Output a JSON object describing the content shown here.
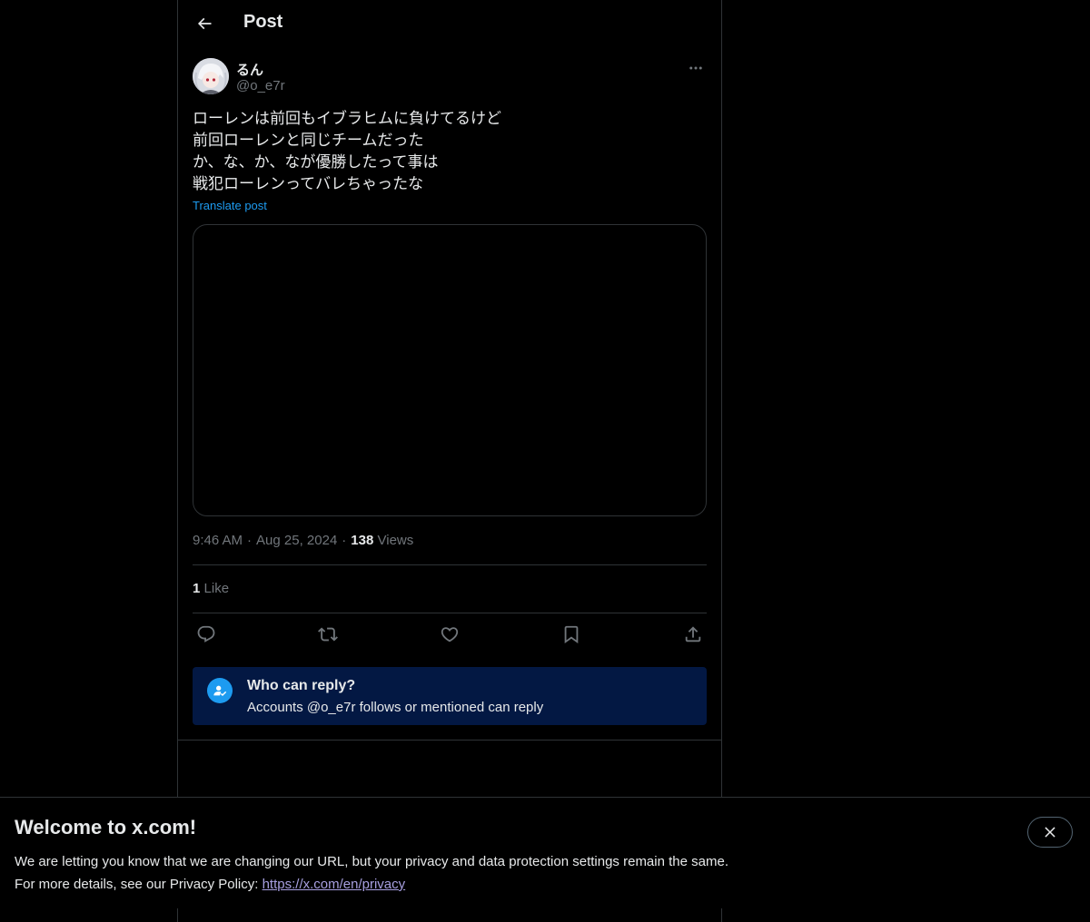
{
  "header": {
    "title": "Post",
    "back_icon": "arrow-left-icon"
  },
  "post": {
    "author": {
      "display_name": "るん",
      "handle": "@o_e7r"
    },
    "text_lines": [
      "ローレンは前回もイブラヒムに負けてるけど",
      "前回ローレンと同じチームだった",
      "か、な、か、なが優勝したって事は",
      "戦犯ローレンってバレちゃったな"
    ],
    "translate_label": "Translate post",
    "time": "9:46 AM",
    "date": "Aug 25, 2024",
    "views_count": "138",
    "views_label": "Views",
    "likes_count": "1",
    "likes_label": "Like"
  },
  "actions": [
    {
      "name": "reply",
      "icon": "comment-icon"
    },
    {
      "name": "repost",
      "icon": "repost-icon"
    },
    {
      "name": "like",
      "icon": "heart-icon"
    },
    {
      "name": "bookmark",
      "icon": "bookmark-icon"
    },
    {
      "name": "share",
      "icon": "share-icon"
    }
  ],
  "reply_restriction": {
    "title": "Who can reply?",
    "subtitle": "Accounts @o_e7r follows or mentioned can reply"
  },
  "banner": {
    "title": "Welcome to x.com!",
    "line1": "We are letting you know that we are changing our URL, but your privacy and data protection settings remain the same.",
    "line2_prefix": "For more details, see our Privacy Policy: ",
    "privacy_link": "https://x.com/en/privacy"
  },
  "colors": {
    "background": "#000000",
    "text": "#e7e9ea",
    "muted": "#71767b",
    "accent": "#1d9bf0",
    "border": "#2f3336",
    "reply_box_bg": "#031843",
    "link": "#a79fe0"
  }
}
